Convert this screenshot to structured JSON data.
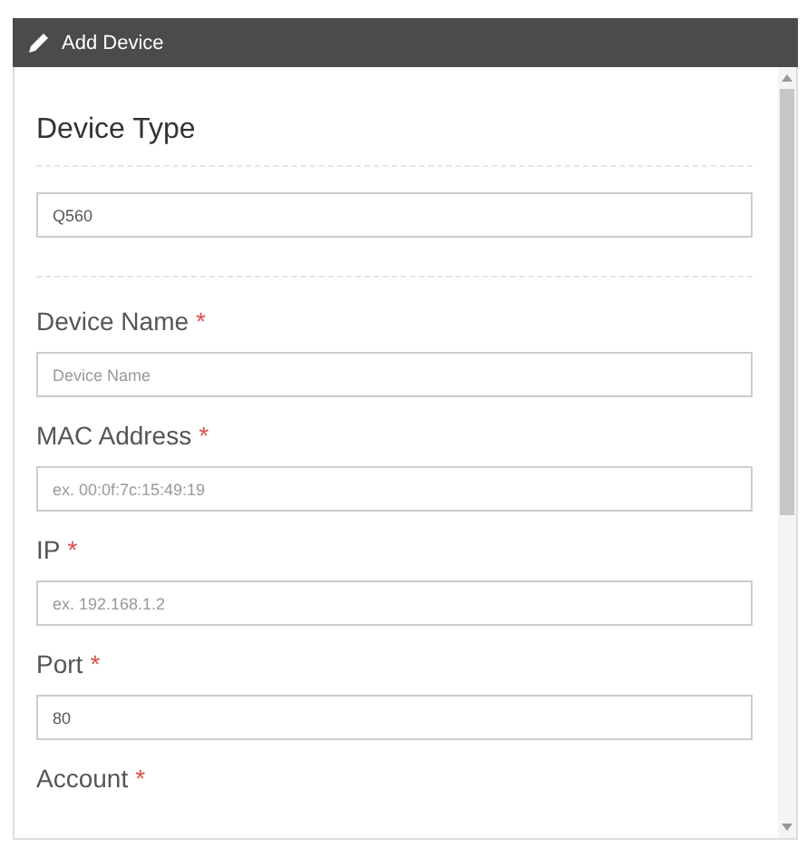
{
  "dialog": {
    "title": "Add Device"
  },
  "sections": [
    {
      "kind": "heading",
      "label": "Device Type",
      "value": "Q560"
    },
    {
      "kind": "field",
      "label": "Device Name",
      "required_mark": "*",
      "placeholder": "Device Name"
    },
    {
      "kind": "field",
      "label": "MAC Address",
      "required_mark": "*",
      "placeholder": "ex. 00:0f:7c:15:49:19"
    },
    {
      "kind": "field",
      "label": "IP",
      "required_mark": "*",
      "placeholder": "ex. 192.168.1.2"
    },
    {
      "kind": "field",
      "label": "Port",
      "required_mark": "*",
      "value": "80"
    },
    {
      "kind": "label",
      "label": "Account",
      "required_mark": "*"
    }
  ]
}
